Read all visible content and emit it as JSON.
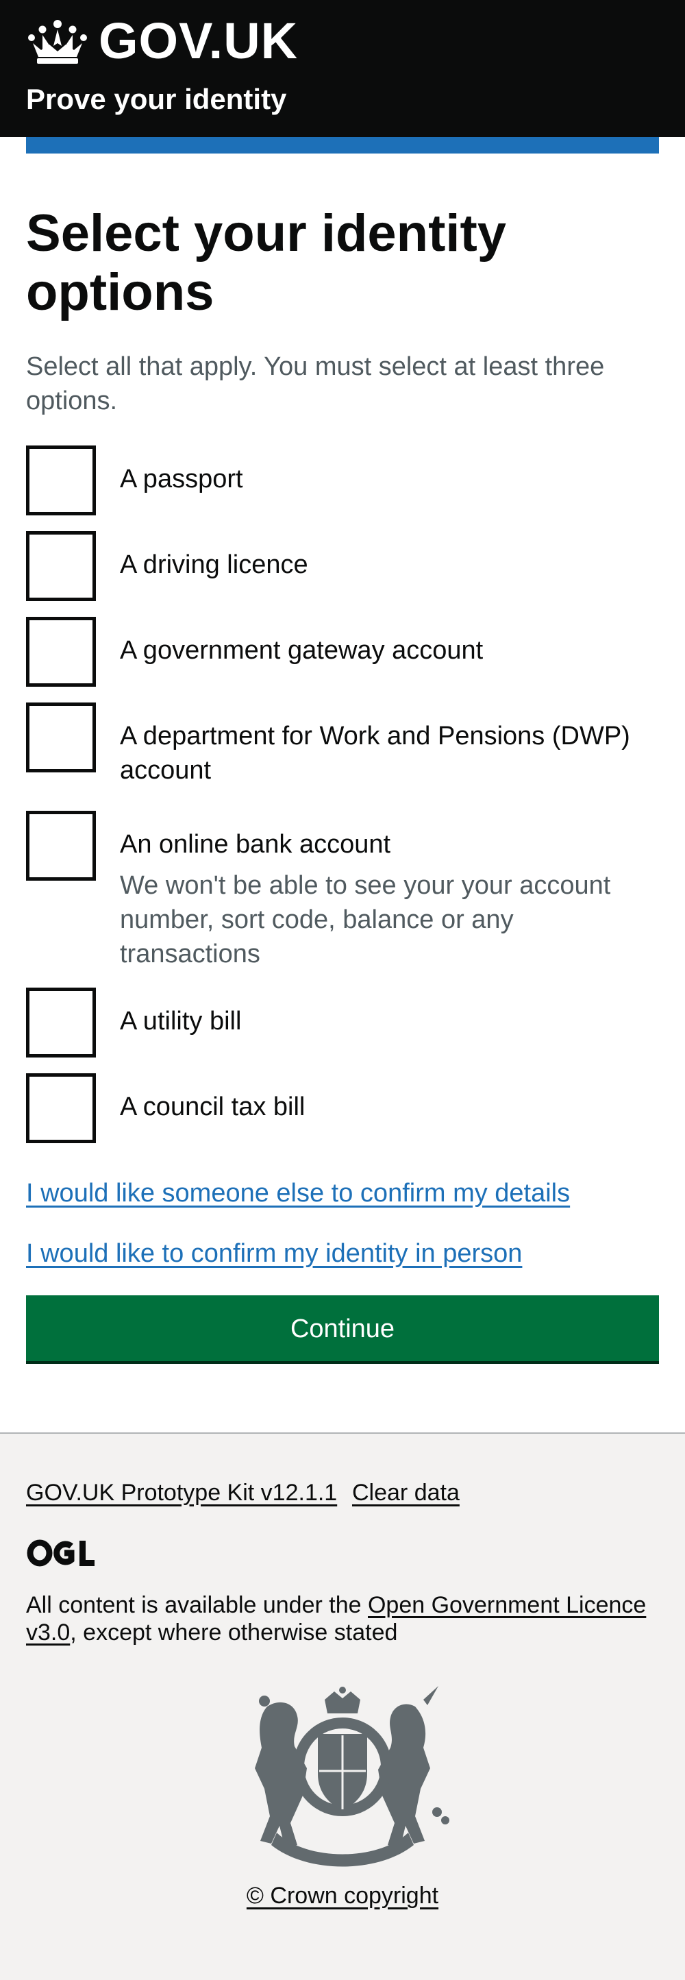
{
  "header": {
    "logo_text": "GOV.UK",
    "service_name": "Prove your identity"
  },
  "main": {
    "title": "Select your identity options",
    "hint": "Select all that apply. You must select at least three options.",
    "options": [
      {
        "label": "A passport",
        "checked": false
      },
      {
        "label": "A driving licence",
        "checked": false
      },
      {
        "label": "A government gateway account",
        "checked": false
      },
      {
        "label": "A department for Work and Pensions (DWP) account",
        "checked": false
      },
      {
        "label": "An online bank account",
        "hint": "We won't be able to see your your account number, sort code, balance or any transactions",
        "checked": false
      },
      {
        "label": "A utility bill",
        "checked": false
      },
      {
        "label": "A council tax bill",
        "checked": false
      }
    ],
    "links": {
      "someone_else": "I would like someone else to confirm my details",
      "in_person": "I would like to confirm my identity in person"
    },
    "continue_label": "Continue"
  },
  "footer": {
    "prototype_kit": "GOV.UK Prototype Kit v12.1.1",
    "clear_data": "Clear data",
    "ogl_logo": "OGL",
    "licence_prefix": "All content is available under the ",
    "licence_link": "Open Government Licence v3.0",
    "licence_suffix": ", except where otherwise stated",
    "copyright": "© Crown copyright"
  },
  "colors": {
    "header_bg": "#0b0c0c",
    "accent_blue": "#1d70b8",
    "button_green": "#00703c",
    "hint_grey": "#505a5f",
    "footer_bg": "#f3f2f1"
  },
  "icons": [
    "crown-icon",
    "ogl-logo",
    "royal-coat-of-arms"
  ]
}
